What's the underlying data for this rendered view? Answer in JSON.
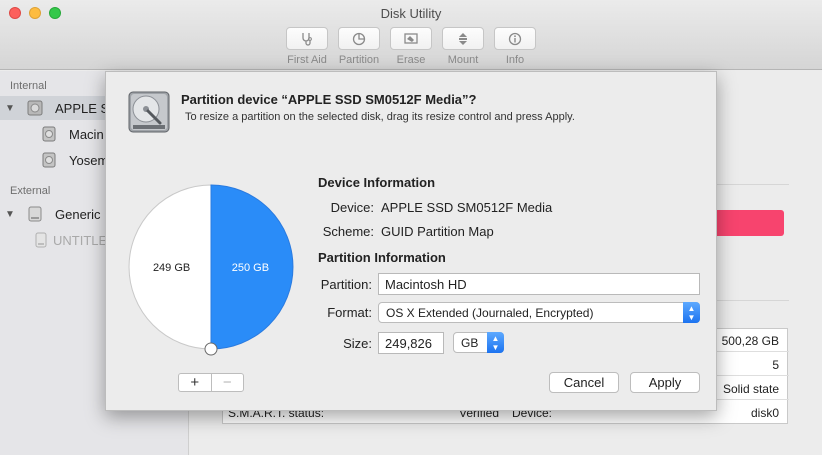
{
  "window": {
    "title": "Disk Utility",
    "toolbar": [
      {
        "label": "First Aid",
        "icon": "stethoscope-icon"
      },
      {
        "label": "Partition",
        "icon": "partition-icon"
      },
      {
        "label": "Erase",
        "icon": "erase-icon"
      },
      {
        "label": "Mount",
        "icon": "mount-icon"
      },
      {
        "label": "Info",
        "icon": "info-icon"
      }
    ]
  },
  "sidebar": {
    "internal_header": "Internal",
    "external_header": "External",
    "items": [
      {
        "label": "APPLE S",
        "selected": true
      },
      {
        "label": "Macin"
      },
      {
        "label": "Yosem"
      },
      {
        "label": "Generic"
      },
      {
        "label": "UNTITLE"
      }
    ]
  },
  "background": {
    "rows": [
      {
        "label": "",
        "value": "500,28 GB"
      },
      {
        "label": "",
        "value": "5"
      },
      {
        "label": "",
        "value": "Solid state"
      },
      {
        "label": "S.M.A.R.T. status:",
        "value_mid": "Verified",
        "label2": "Device:",
        "value": "disk0"
      }
    ],
    "colors": {
      "accent_bar": "#f7446e"
    }
  },
  "sheet": {
    "heading": "Partition device “APPLE SSD SM0512F Media”?",
    "subheading": "To resize a partition on the selected disk, drag its resize control and press Apply.",
    "pie": {
      "slices": [
        {
          "label": "249 GB",
          "fraction": 0.5,
          "color": "#ffffff"
        },
        {
          "label": "250 GB",
          "fraction": 0.5,
          "color": "#2a8cf8"
        }
      ]
    },
    "pie_add": "+",
    "pie_remove": "−",
    "device_info": {
      "title": "Device Information",
      "device_label": "Device:",
      "device_value": "APPLE SSD SM0512F Media",
      "scheme_label": "Scheme:",
      "scheme_value": "GUID Partition Map"
    },
    "partition_info": {
      "title": "Partition Information",
      "partition_label": "Partition:",
      "partition_value": "Macintosh HD",
      "format_label": "Format:",
      "format_value": "OS X Extended (Journaled, Encrypted)",
      "size_label": "Size:",
      "size_value": "249,826",
      "size_unit": "GB"
    },
    "cancel_label": "Cancel",
    "apply_label": "Apply"
  }
}
